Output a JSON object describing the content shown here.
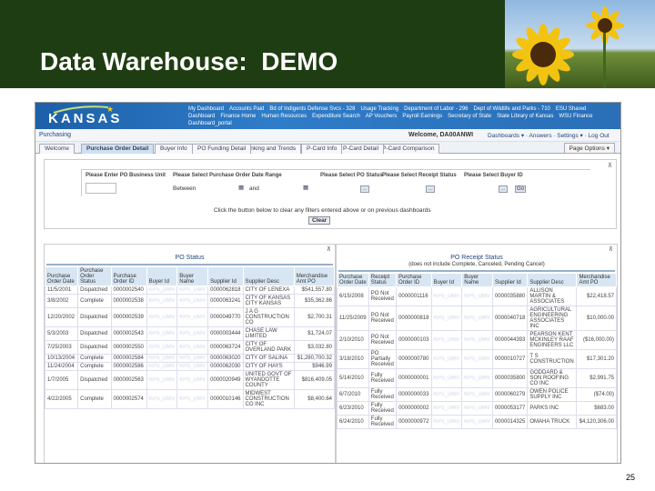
{
  "slide": {
    "title": "Data Warehouse:  DEMO",
    "page_number": "25"
  },
  "banner": {
    "logo": "KANSAS",
    "links": [
      "My Dashboard",
      "Accounts Paid",
      "Bd of Indigents Defense Svcs - 328",
      "Usage Tracking",
      "Department of Labor - 296",
      "Dept of Wildlife and Parks - 710",
      "ESU Shared Dashboard",
      "Finance Home",
      "Human Resources",
      "Expenditure Search",
      "AP Vouchers",
      "Payroll Earnings",
      "Secretary of State",
      "State Library of Kansas",
      "WSU Finance Dashboard_portal"
    ]
  },
  "header": {
    "section": "Purchasing",
    "welcome": "Welcome, DA00ANWI",
    "nav": "Dashboards ▾ · Answers · Settings ▾ · Log Out"
  },
  "tabs": [
    "Welcome",
    "Purchase Order Detail",
    "Buyer Info",
    "PO Funding Detail",
    "Ranking and Trends",
    "P-Card Info",
    "P-Card Detail",
    "P-Card Comparison"
  ],
  "page_options": "Page Options ▾",
  "filters": {
    "business_unit": "Please Enter PO Business Unit",
    "date_range": "Please Select Purchase Order Date Range",
    "between": "Between",
    "and": "and",
    "po_status": "Please Select PO Status",
    "receipt_status": "Please Select Receipt Status",
    "buyer_id": "Please Select Buyer ID",
    "go": "Go",
    "more": "...",
    "clear_msg": "Click the button below to clear any filters entered above or on previous dashboards",
    "clear": "Clear"
  },
  "po_status": {
    "title": "PO Status",
    "headers": [
      "Purchase Order Date",
      "Purchase Order Status",
      "Purchase Order ID",
      "Buyer Id",
      "Buyer Name",
      "Supplier Id",
      "Supplier Desc",
      "Merchandise Amt PO"
    ],
    "rows": [
      [
        "11/5/2001",
        "Dispatched",
        "0000002540",
        "KPS_DMV",
        "KPS_DMV",
        "0000062818",
        "CITY OF LENEXA",
        "$541,557.80"
      ],
      [
        "3/8/2002",
        "Complete",
        "0000002538",
        "KPS_DMV",
        "KPS_DMV",
        "0000063241",
        "CITY OF KANSAS CITY KANSAS",
        "$35,362.86"
      ],
      [
        "12/20/2002",
        "Dispatched",
        "0000002539",
        "KPS_DMV",
        "KPS_DMV",
        "0000049770",
        "J A G CONSTRUCTION CO",
        "$2,700.31"
      ],
      [
        "5/3/2003",
        "Dispatched",
        "0000002543",
        "KPS_DMV",
        "KPS_DMV",
        "0000003444",
        "CHASE LAW LIMITED",
        "$1,724.07"
      ],
      [
        "7/25/2003",
        "Dispatched",
        "0000002550",
        "KPS_DMV",
        "KPS_DMV",
        "0000063724",
        "CITY OF OVERLAND PARK",
        "$3,032.80"
      ],
      [
        "10/13/2004",
        "Complete",
        "0000002584",
        "KPS_DMV",
        "KPS_DMV",
        "0000063020",
        "CITY OF SALINA",
        "$1,280,700.32"
      ],
      [
        "11/24/2004",
        "Complete",
        "0000002586",
        "KPS_DMV",
        "KPS_DMV",
        "0000062030",
        "CITY OF HAYS",
        "$946.99"
      ],
      [
        "1/7/2005",
        "Dispatched",
        "0000002563",
        "KPS_DMV",
        "KPS_DMV",
        "0000020949",
        "UNITED GOVT OF WYANDOTTE COUNTY",
        "$816,409.05"
      ],
      [
        "4/22/2005",
        "Complete",
        "0000002574",
        "KPS_DMV",
        "KPS_DMV",
        "0000010146",
        "MIDWEST CONSTRUCTION CO INC",
        "$8,400.64"
      ]
    ]
  },
  "po_receipt": {
    "title": "PO Receipt Status",
    "subtitle": "(does not include Complete, Canceled, Pending Cancel)",
    "headers": [
      "Purchase Order Date",
      "Receipt Status",
      "Purchase Order ID",
      "Buyer Id",
      "Buyer Name",
      "Supplier Id",
      "Supplier Desc",
      "Merchandise Amt PO"
    ],
    "rows": [
      [
        "6/15/2008",
        "PO Not Received",
        "0000001116",
        "KPS_DMV",
        "KPS_DMV",
        "0000035880",
        "ALLISON MARTIN & ASSOCIATES",
        "$22,418.57"
      ],
      [
        "11/25/2009",
        "PO Not Received",
        "0000000818",
        "KPS_DMV",
        "KPS_DMV",
        "0000040718",
        "AGRICULTURAL ENGINEERING ASSOCIATES INC",
        "$10,000.00"
      ],
      [
        "2/10/2010",
        "PO Not Received",
        "0000000103",
        "KPS_DMV",
        "KPS_DMV",
        "0000044393",
        "PEARSON KENT MCKINLEY RAAF ENGINEERS LLC",
        "($16,000.00)"
      ],
      [
        "3/18/2010",
        "PO Partially Received",
        "0000000780",
        "KPS_DMV",
        "KPS_DMV",
        "0000010727",
        "T S CONSTRUCTION",
        "$17,301.20"
      ],
      [
        "5/14/2010",
        "Fully Received",
        "0000000001",
        "KPS_DMV",
        "KPS_DMV",
        "0000035800",
        "GODDARD & SON ROOFING CO INC",
        "$2,991.75"
      ],
      [
        "6/7/2010",
        "Fully Received",
        "0000000033",
        "KPS_DMV",
        "KPS_DMV",
        "0000060279",
        "OWEN POLICE SUPPLY INC",
        "($74.00)"
      ],
      [
        "6/23/2010",
        "Fully Received",
        "0000000002",
        "KPS_DMV",
        "KPS_DMV",
        "0000053177",
        "PARKS INC",
        "$683.00"
      ],
      [
        "6/24/2010",
        "Fully Received",
        "0000000972",
        "KPS_DMV",
        "KPS_DMV",
        "0000014325",
        "OMAHA TRUCK",
        "$4,120,306.00"
      ]
    ]
  }
}
